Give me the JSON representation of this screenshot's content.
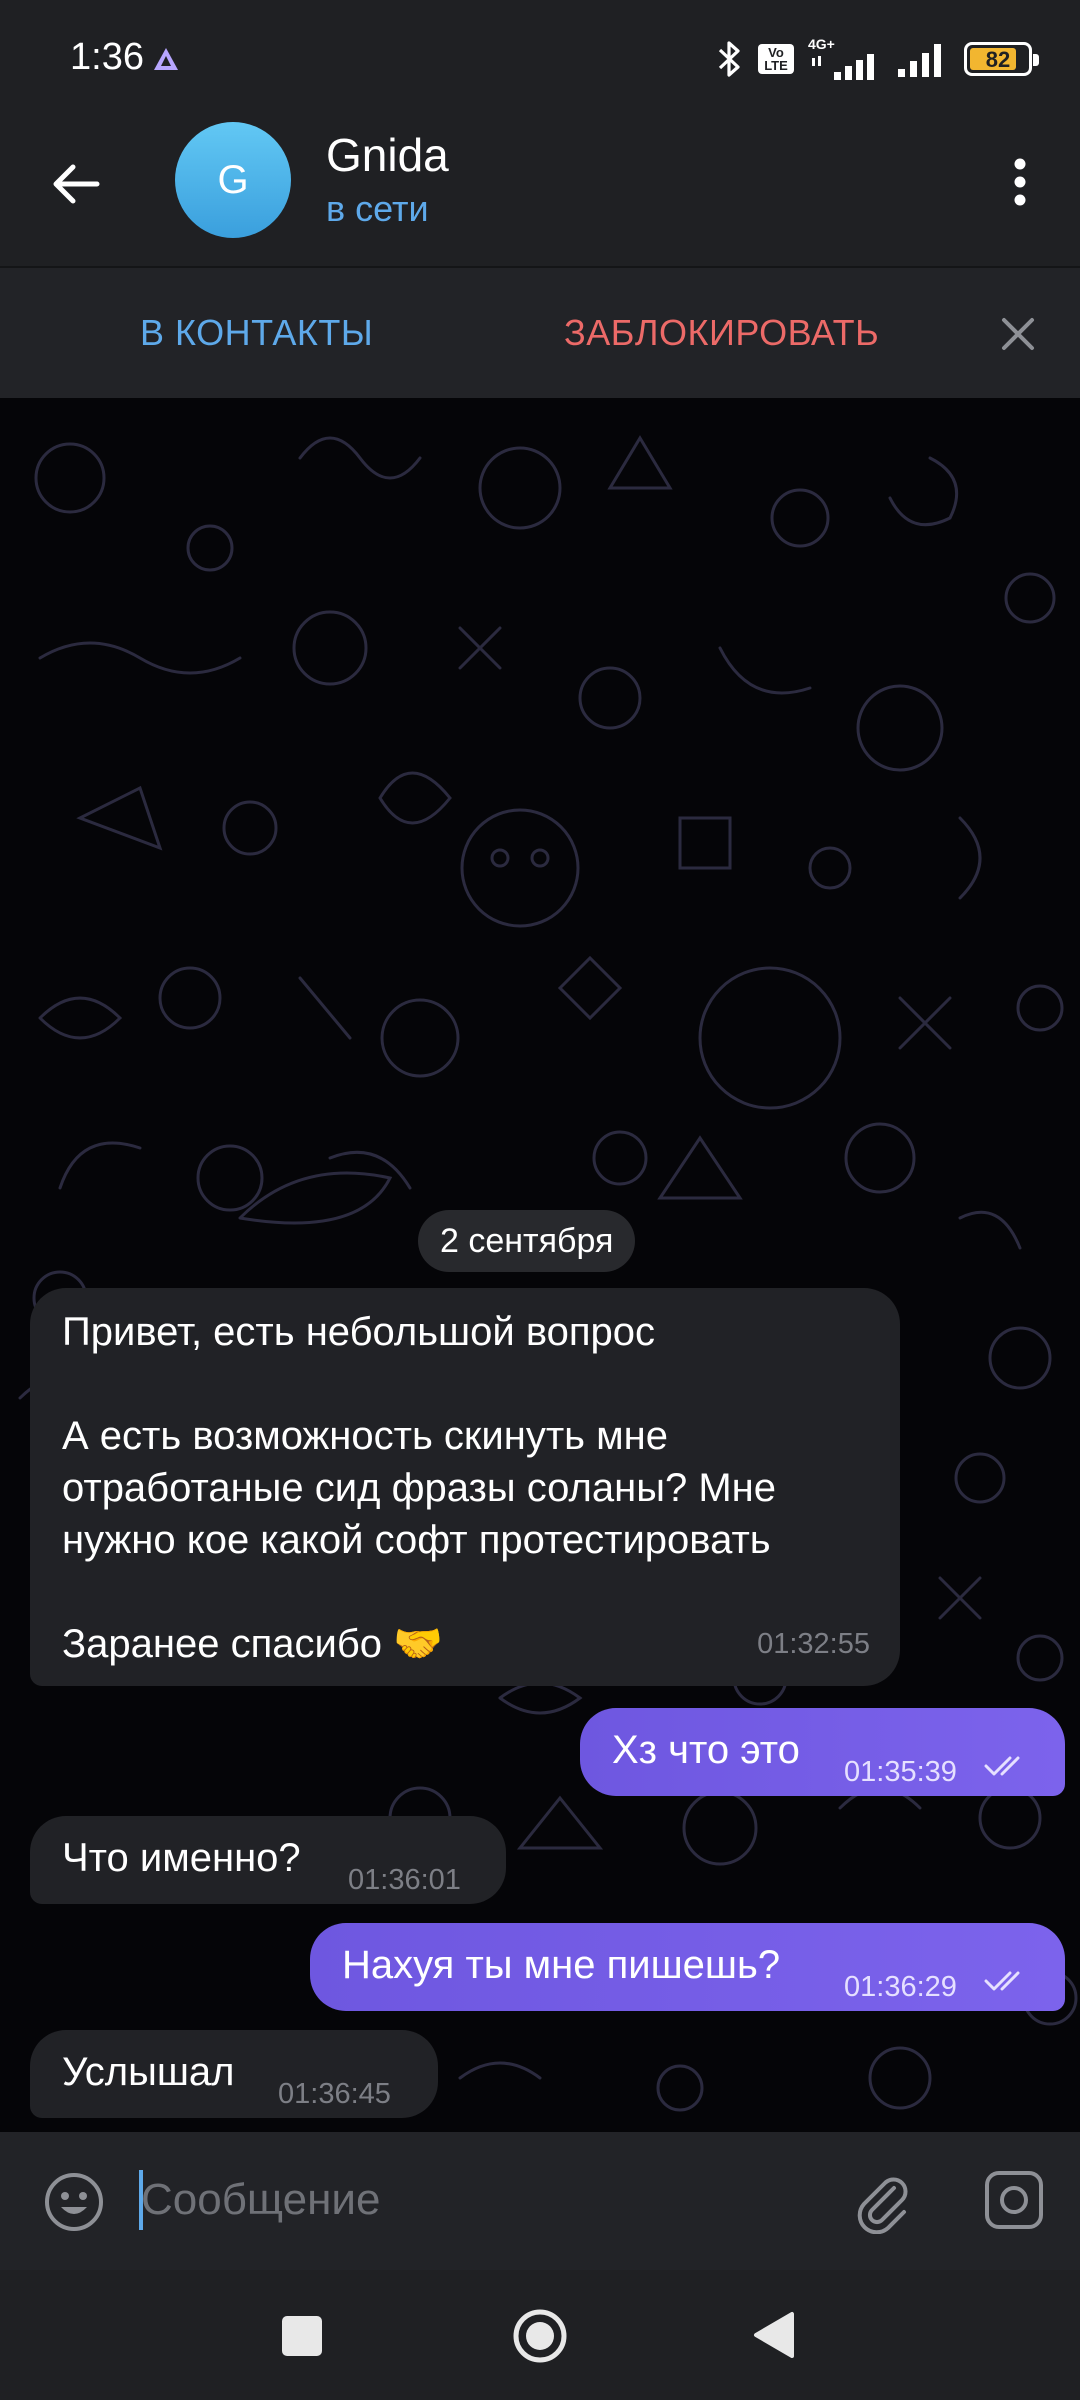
{
  "status_bar": {
    "time": "1:36",
    "network": "4G+",
    "volte": "Vo LTE",
    "battery": 82,
    "battery_text": "82",
    "battery_color": "#f2b630"
  },
  "header": {
    "avatar_letter": "G",
    "contact_name": "Gnida",
    "contact_status": "в сети",
    "back_icon": "arrow-left-icon",
    "more_icon": "more-vertical-icon"
  },
  "action_bar": {
    "add_contact": "В КОНТАКТЫ",
    "block": "ЗАБЛОКИРОВАТЬ",
    "close_icon": "close-icon"
  },
  "chat": {
    "date_separator": "2 сентября",
    "messages": [
      {
        "direction": "in",
        "text": "Привет, есть небольшой вопрос\n\nА есть возможность скинуть мне отработаные сид фразы соланы? Мне нужно кое какой софт протестировать\n\nЗаранее спасибо 🤝",
        "time": "01:32:55"
      },
      {
        "direction": "out",
        "text": "Хз что это",
        "time": "01:35:39",
        "read": true
      },
      {
        "direction": "in",
        "text": "Что именно?",
        "time": "01:36:01"
      },
      {
        "direction": "out",
        "text": "Нахуя ты мне пишешь?",
        "time": "01:36:29",
        "read": true
      },
      {
        "direction": "in",
        "text": "Услышал",
        "time": "01:36:45"
      }
    ]
  },
  "input": {
    "placeholder": "Сообщение",
    "value": ""
  },
  "colors": {
    "accent": "#5ea9ea",
    "danger": "#ec6a68",
    "outgoing_bubble": "#7560e6",
    "incoming_bubble": "#212226"
  }
}
